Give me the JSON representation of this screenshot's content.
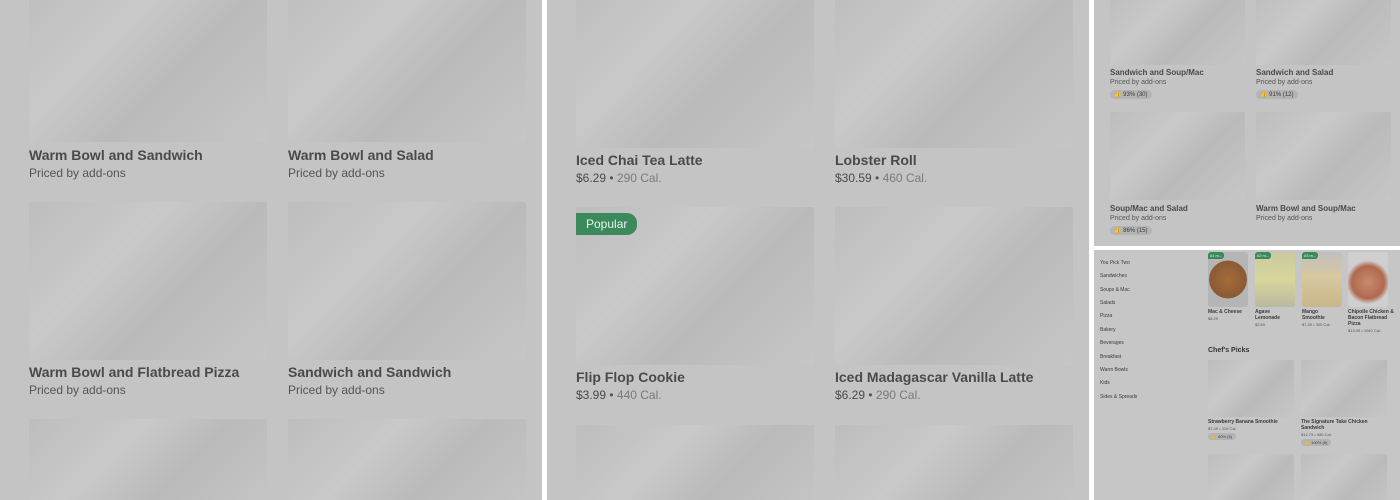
{
  "panel1": {
    "cards": [
      {
        "title": "Warm Bowl and Sandwich",
        "sub": "Priced by add-ons"
      },
      {
        "title": "Warm Bowl and Salad",
        "sub": "Priced by add-ons"
      },
      {
        "title": "Warm Bowl and Flatbread Pizza",
        "sub": "Priced by add-ons"
      },
      {
        "title": "Sandwich and Sandwich",
        "sub": "Priced by add-ons"
      }
    ]
  },
  "panel2": {
    "cards": [
      {
        "title": "Iced Chai Tea Latte",
        "price": "$6.29",
        "cal": "290 Cal."
      },
      {
        "title": "Lobster Roll",
        "price": "$30.59",
        "cal": "460 Cal."
      },
      {
        "title": "Flip Flop Cookie",
        "price": "$3.99",
        "cal": "440 Cal.",
        "badge": "Popular"
      },
      {
        "title": "Iced Madagascar Vanilla Latte",
        "price": "$6.29",
        "cal": "290 Cal."
      }
    ]
  },
  "panel3": {
    "cards": [
      {
        "title": "Sandwich and Soup/Mac",
        "sub": "Priced by add-ons",
        "rating": "93% (30)"
      },
      {
        "title": "Sandwich and Salad",
        "sub": "Priced by add-ons",
        "rating": "91% (12)"
      },
      {
        "title": "Soup/Mac and Salad",
        "sub": "Priced by add-ons",
        "rating": "86% (15)"
      },
      {
        "title": "Warm Bowl and Soup/Mac",
        "sub": "Priced by add-ons"
      }
    ]
  },
  "panel4": {
    "nav": [
      "You Pick Two",
      "Sandwiches",
      "Soups & Mac",
      "Salads",
      "Pizza",
      "Bakery",
      "Beverages",
      "Breakfast",
      "Warm Bowls",
      "Kids",
      "Sides & Spreads"
    ],
    "popular": [
      {
        "title": "Mac & Cheese",
        "price": "$8.29",
        "tag": "#1 m..."
      },
      {
        "title": "Agave Lemonade",
        "price": "$3.69",
        "tag": "#2 m..."
      },
      {
        "title": "Mango Smoothie",
        "price": "$7.49",
        "cal": "300 Cal.",
        "tag": "#3 m..."
      },
      {
        "title": "Chipotle Chicken & Bacon Flatbread Pizza",
        "price": "$13.09",
        "cal": "1040 Cal."
      }
    ],
    "section_title": "Chef's Picks",
    "chefs": [
      {
        "title": "Strawberry Banana Smoothie",
        "price": "$7.49",
        "cal": "310 Cal.",
        "rating": "80% (5)"
      },
      {
        "title": "The Signature Take Chicken Sandwich",
        "price": "$12.79",
        "cal": "980 Cal.",
        "rating": "100% (8)"
      }
    ]
  },
  "colors": {
    "badge_green": "#3b8a5b",
    "overlay_gray": "#c4c4c4"
  }
}
